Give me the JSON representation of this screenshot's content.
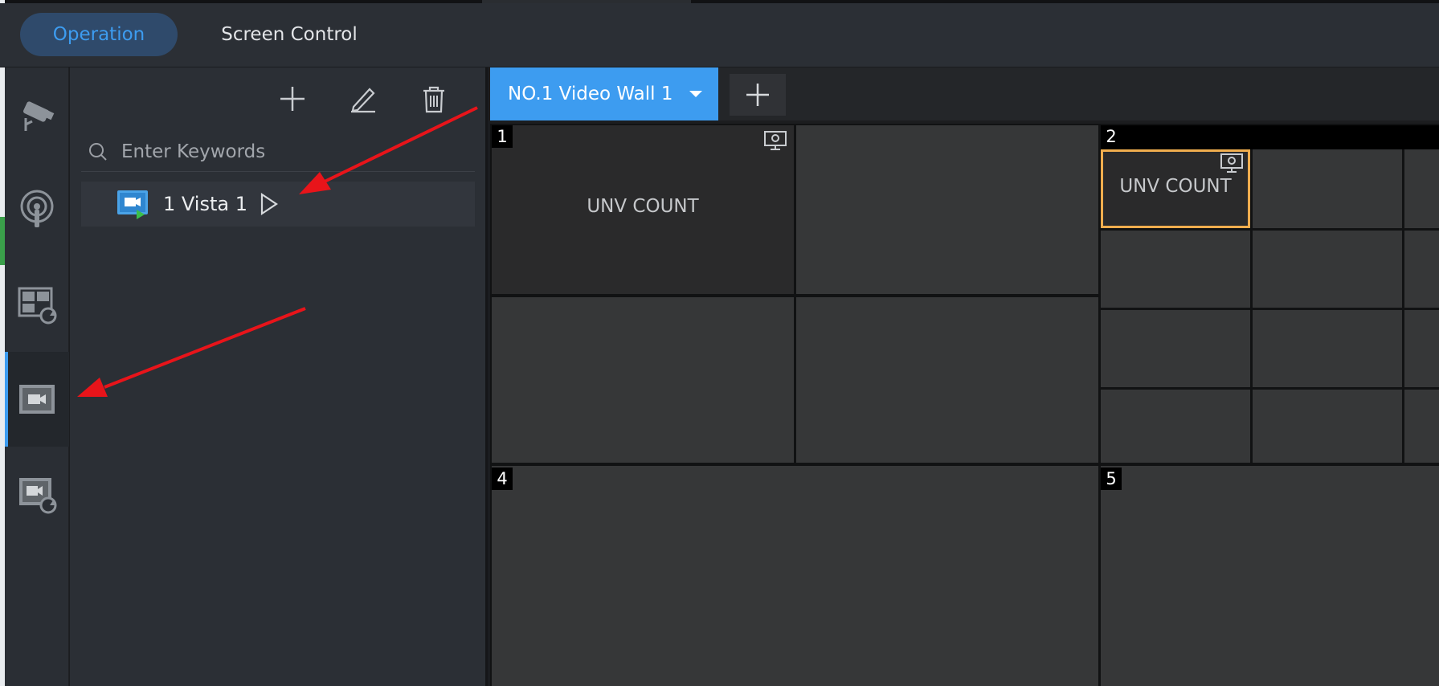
{
  "header": {
    "tabs": [
      {
        "label": "Operation",
        "active": true
      },
      {
        "label": "Screen Control",
        "active": false
      }
    ]
  },
  "rail": {
    "items": [
      {
        "name": "camera-icon",
        "active": false
      },
      {
        "name": "alarm-icon",
        "active": false
      },
      {
        "name": "layout-cycle-icon",
        "active": false
      },
      {
        "name": "video-wall-icon",
        "active": true
      },
      {
        "name": "scene-cycle-icon",
        "active": false
      }
    ]
  },
  "panel": {
    "search_placeholder": "Enter Keywords",
    "tree": [
      {
        "label": "1 Vista 1"
      }
    ]
  },
  "wall": {
    "tab_label": "NO.1 Video Wall 1",
    "screens": [
      {
        "number": "1",
        "cell_text": "UNV COUNT"
      },
      {
        "number": "2",
        "cell_text": "UNV COUNT"
      },
      {
        "number": "4"
      },
      {
        "number": "5"
      }
    ]
  },
  "colors": {
    "accent": "#3d9cf0",
    "selected_border": "#f0ad4e",
    "annotation_arrow": "#e8141a"
  }
}
